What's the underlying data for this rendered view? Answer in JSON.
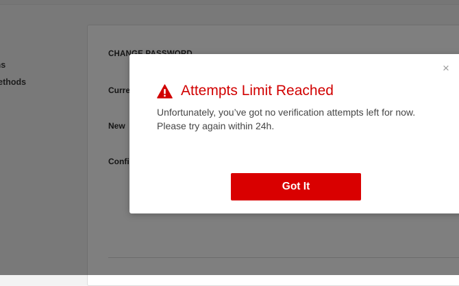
{
  "sidebar": {
    "items": [
      {
        "label": "ons"
      },
      {
        "label": "methods"
      }
    ]
  },
  "settings_panel": {
    "section_title": "CHANGE PASSWORD",
    "fields": [
      {
        "label": "Curre"
      },
      {
        "label": "New"
      },
      {
        "label": "Confi"
      }
    ]
  },
  "modal": {
    "icon": "warning-icon",
    "title": "Attempts Limit Reached",
    "message": "Unfortunately, you’ve got no verification attempts left for now. Please try again within 24h.",
    "button_label": "Got It",
    "close_label": "×"
  },
  "colors": {
    "accent": "#d90000",
    "title_red": "#d10000",
    "overlay": "rgba(0,0,0,0.5)"
  }
}
